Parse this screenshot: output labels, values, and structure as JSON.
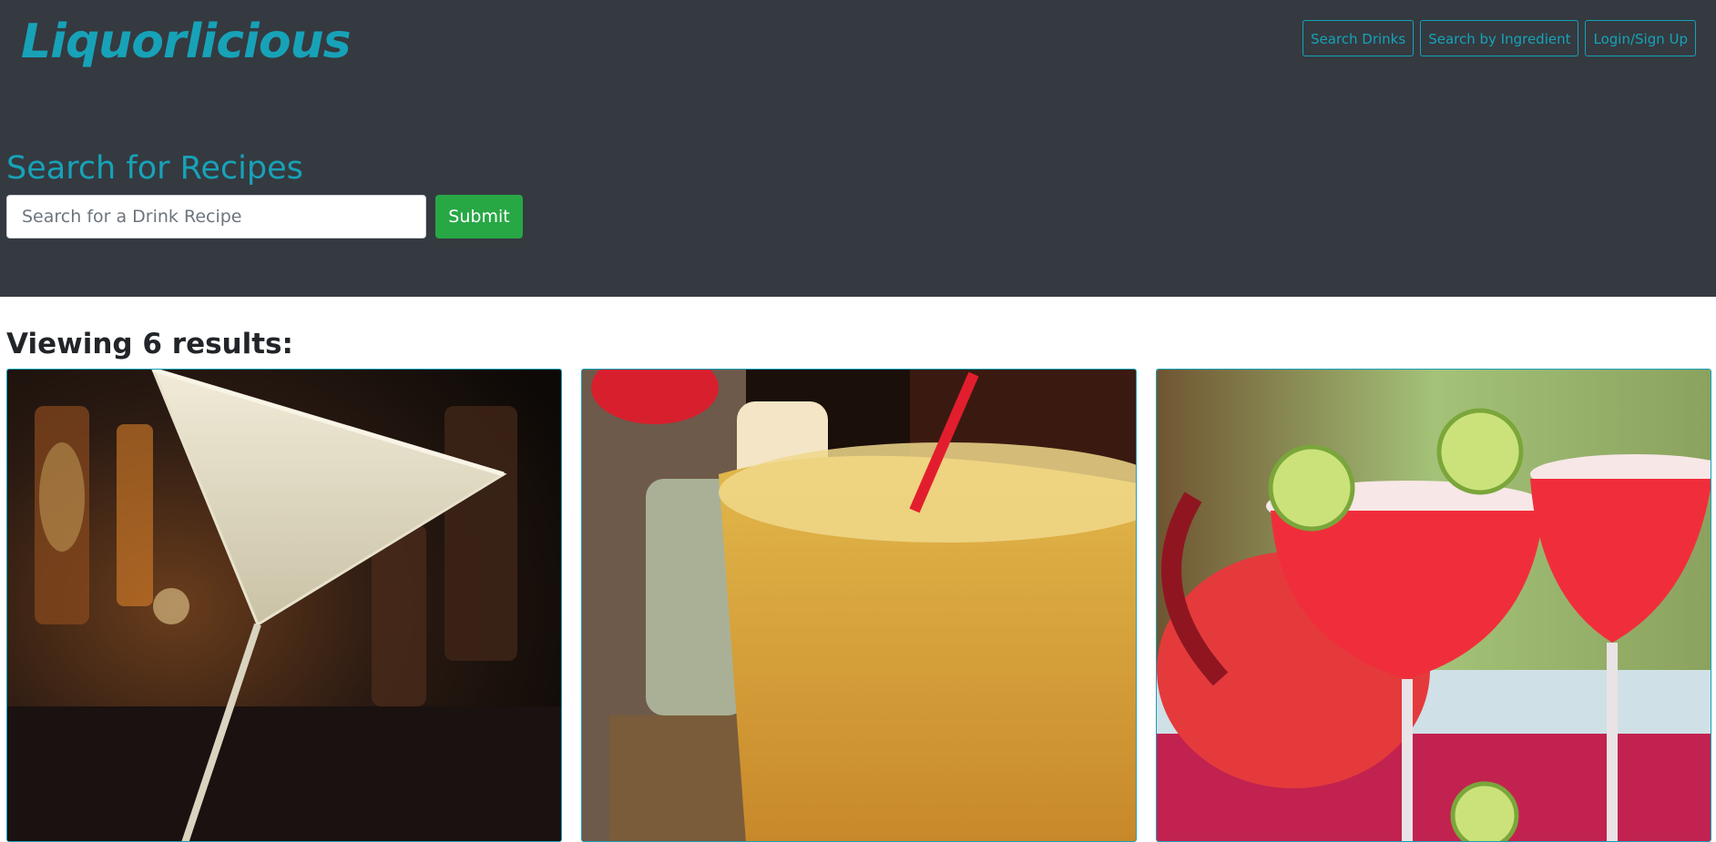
{
  "header": {
    "brand": "Liquorlicious",
    "nav": [
      {
        "label": "Search Drinks"
      },
      {
        "label": "Search by Ingredient"
      },
      {
        "label": "Login/Sign Up"
      }
    ]
  },
  "search": {
    "title": "Search for Recipes",
    "placeholder": "Search for a Drink Recipe",
    "value": "",
    "submit_label": "Submit"
  },
  "results": {
    "heading": "Viewing 6 results:",
    "count": 6,
    "cards": [
      {
        "image": "martini-glass-drink-photo",
        "label_visible": ""
      },
      {
        "image": "iced-yellow-drink-with-straw-photo",
        "label_visible": ""
      },
      {
        "image": "red-margarita-with-lime-photo",
        "label_visible": ""
      }
    ]
  },
  "colors": {
    "header_bg": "#343a40",
    "accent": "#17a2b8",
    "submit_bg": "#28a745",
    "page_bg": "#ffffff",
    "text_dark": "#212529"
  }
}
